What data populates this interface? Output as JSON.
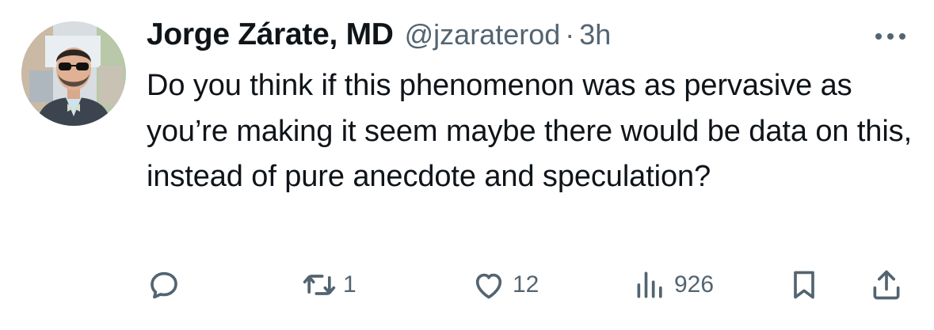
{
  "tweet": {
    "author": {
      "display_name": "Jorge Zárate, MD",
      "handle": "@jzaraterod",
      "separator": "·",
      "timestamp": "3h"
    },
    "text": "Do you think if this phenomenon was as pervasive as you’re making it seem maybe there would be data on this, instead of pure anecdote and speculation?",
    "actions": {
      "reply": {
        "icon": "reply-icon",
        "count": ""
      },
      "retweet": {
        "icon": "retweet-icon",
        "count": "1"
      },
      "like": {
        "icon": "heart-icon",
        "count": "12"
      },
      "views": {
        "icon": "views-icon",
        "count": "926"
      },
      "bookmark": {
        "icon": "bookmark-icon"
      },
      "share": {
        "icon": "share-icon"
      }
    }
  },
  "colors": {
    "text_primary": "#0f1419",
    "text_secondary": "#536471",
    "background": "#ffffff"
  }
}
